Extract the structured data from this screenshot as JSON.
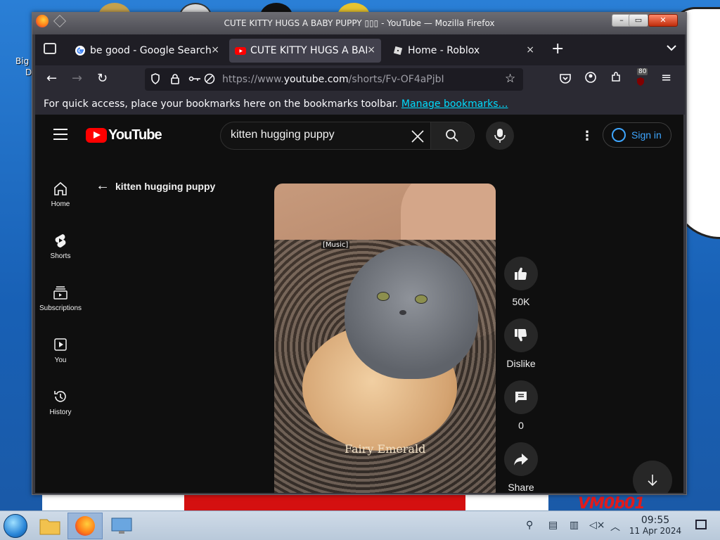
{
  "desktop": {
    "icon_label_line1": "Big",
    "icon_label_line2": "De",
    "wallpaper_text": "VM0b01"
  },
  "window": {
    "title": "CUTE KITTY HUGS A BABY PUPPY ▯▯▯ - YouTube — Mozilla Firefox"
  },
  "tabs": [
    {
      "label": "be good - Google Search",
      "close": "×",
      "favicon": "google-icon"
    },
    {
      "label": "CUTE KITTY HUGS A BABY",
      "close": "×",
      "favicon": "youtube-icon"
    },
    {
      "label": "Home - Roblox",
      "close": "×",
      "favicon": "roblox-icon"
    }
  ],
  "toolbar": {
    "new_tab": "+",
    "url_prefix": "https://www.",
    "url_domain": "youtube.com",
    "url_path": "/shorts/Fv-OF4aPjbI",
    "extensions_badge": "80"
  },
  "bookmarks_bar": {
    "message": "For quick access, place your bookmarks here on the bookmarks toolbar.",
    "link": "Manage bookmarks…"
  },
  "youtube": {
    "logo_text": "YouTube",
    "search_value": "kitten hugging puppy",
    "sign_in": "Sign in",
    "sidebar": [
      {
        "label": "Home"
      },
      {
        "label": "Shorts"
      },
      {
        "label": "Subscriptions"
      },
      {
        "label": "You"
      },
      {
        "label": "History"
      }
    ],
    "back_label": "kitten hugging puppy",
    "video": {
      "caption": "[Music]",
      "watermark": "Fairy Emerald"
    },
    "actions": {
      "like_count": "50K",
      "dislike_label": "Dislike",
      "comments_count": "0",
      "share_label": "Share"
    }
  },
  "taskbar": {
    "time": "09:55",
    "date": "11 Apr 2024"
  },
  "colors": {
    "accent_link": "#00ddff",
    "youtube_red": "#ff0000",
    "signin_blue": "#3ea6ff"
  }
}
